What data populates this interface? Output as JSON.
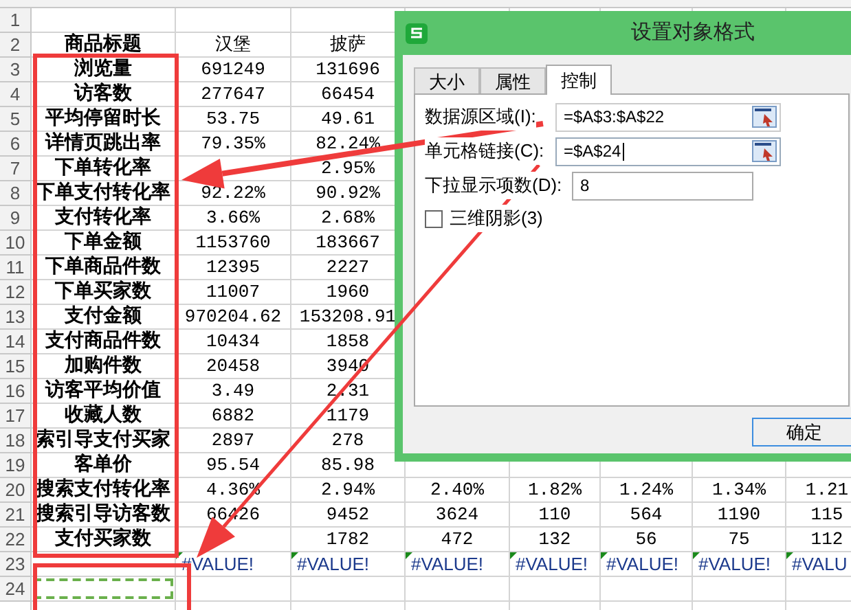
{
  "rows": [
    {
      "number": "1",
      "cells": []
    },
    {
      "number": "2",
      "cells": [
        "商品标题",
        "汉堡",
        "披萨"
      ]
    },
    {
      "number": "3",
      "cells": [
        "浏览量",
        "691249",
        "131696"
      ]
    },
    {
      "number": "4",
      "cells": [
        "访客数",
        "277647",
        "66454"
      ]
    },
    {
      "number": "5",
      "cells": [
        "平均停留时长",
        "53.75",
        "49.61"
      ]
    },
    {
      "number": "6",
      "cells": [
        "详情页跳出率",
        "79.35%",
        "82.24%"
      ]
    },
    {
      "number": "7",
      "cells": [
        "下单转化率",
        null,
        "2.95%"
      ]
    },
    {
      "number": "8",
      "cells": [
        "下单支付转化率",
        "92.22%",
        "90.92%"
      ]
    },
    {
      "number": "9",
      "cells": [
        "支付转化率",
        "3.66%",
        "2.68%"
      ]
    },
    {
      "number": "10",
      "cells": [
        "下单金额",
        "1153760",
        "183667"
      ]
    },
    {
      "number": "11",
      "cells": [
        "下单商品件数",
        "12395",
        "2227"
      ]
    },
    {
      "number": "12",
      "cells": [
        "下单买家数",
        "11007",
        "1960"
      ]
    },
    {
      "number": "13",
      "cells": [
        "支付金额",
        "970204.62",
        "153208.91"
      ]
    },
    {
      "number": "14",
      "cells": [
        "支付商品件数",
        "10434",
        "1858"
      ]
    },
    {
      "number": "15",
      "cells": [
        "加购件数",
        "20458",
        "3940"
      ]
    },
    {
      "number": "16",
      "cells": [
        "访客平均价值",
        "3.49",
        "2.31"
      ]
    },
    {
      "number": "17",
      "cells": [
        "收藏人数",
        "6882",
        "1179"
      ]
    },
    {
      "number": "18",
      "cells": [
        "索引导支付买家",
        "2897",
        "278"
      ]
    },
    {
      "number": "19",
      "cells": [
        "客单价",
        "95.54",
        "85.98"
      ]
    },
    {
      "number": "20",
      "cells": [
        "搜索支付转化率",
        "4.36%",
        "2.94%",
        "2.40%",
        "1.82%",
        "1.24%",
        "1.34%",
        "1.21"
      ]
    },
    {
      "number": "21",
      "cells": [
        "搜索引导访客数",
        "66426",
        "9452",
        "3624",
        "110",
        "564",
        "1190",
        "115"
      ]
    },
    {
      "number": "22",
      "cells": [
        "支付买家数",
        null,
        "1782",
        "472",
        "132",
        "56",
        "75",
        "112"
      ]
    },
    {
      "number": "23",
      "flagged": true,
      "cells": [
        null,
        "#VALUE!",
        "#VALUE!",
        "#VALUE!",
        "#VALUE!",
        "#VALUE!",
        "#VALUE!",
        "#VALU"
      ]
    },
    {
      "number": "24",
      "marquee": true,
      "cells": []
    }
  ],
  "dialog": {
    "title": "设置对象格式",
    "tabs": [
      {
        "label": "大小",
        "selected": false
      },
      {
        "label": "属性",
        "selected": false
      },
      {
        "label": "控制",
        "selected": true
      }
    ],
    "fields": [
      {
        "kind": "range",
        "label": "数据源区域(I):",
        "value": "=$A$3:$A$22",
        "focused": false
      },
      {
        "kind": "range",
        "label": "单元格链接(C):",
        "value": "=$A$24",
        "focused": true
      },
      {
        "kind": "number",
        "label": "下拉显示项数(D):",
        "value": "8",
        "focused": false
      }
    ],
    "checkbox": {
      "label": "三维阴影(3)",
      "checked": false
    },
    "button": "确定"
  }
}
